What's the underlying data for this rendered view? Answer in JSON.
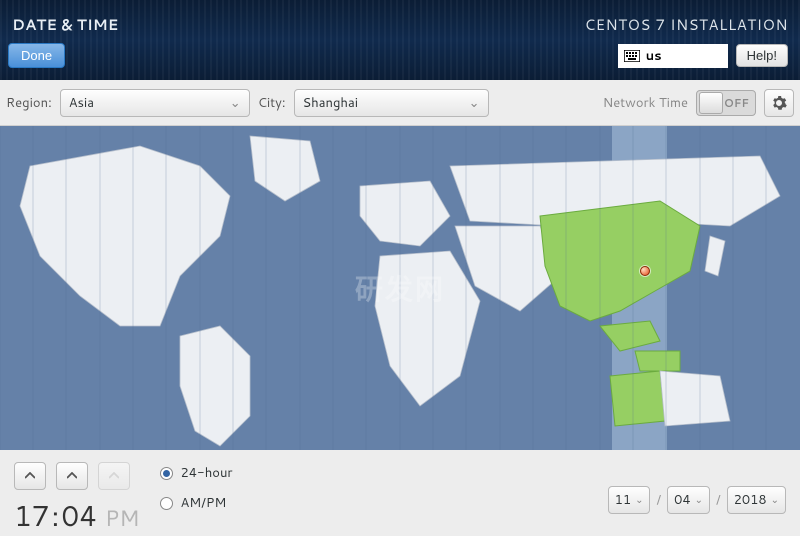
{
  "header": {
    "page_title": "DATE & TIME",
    "install_title": "CENTOS 7 INSTALLATION",
    "done_label": "Done",
    "help_label": "Help!",
    "keyboard_layout": "us"
  },
  "selectors": {
    "region_label": "Region:",
    "region_value": "Asia",
    "city_label": "City:",
    "city_value": "Shanghai",
    "network_time_label": "Network Time",
    "network_time_state": "OFF"
  },
  "map": {
    "watermark": "研发网"
  },
  "time": {
    "hour": "17",
    "minute": "04",
    "separator": ":",
    "ampm": "PM"
  },
  "format": {
    "option_24h": "24-hour",
    "option_ampm": "AM/PM",
    "selected": "24-hour"
  },
  "date": {
    "day": "11",
    "month": "04",
    "year": "2018",
    "separator": "/"
  }
}
